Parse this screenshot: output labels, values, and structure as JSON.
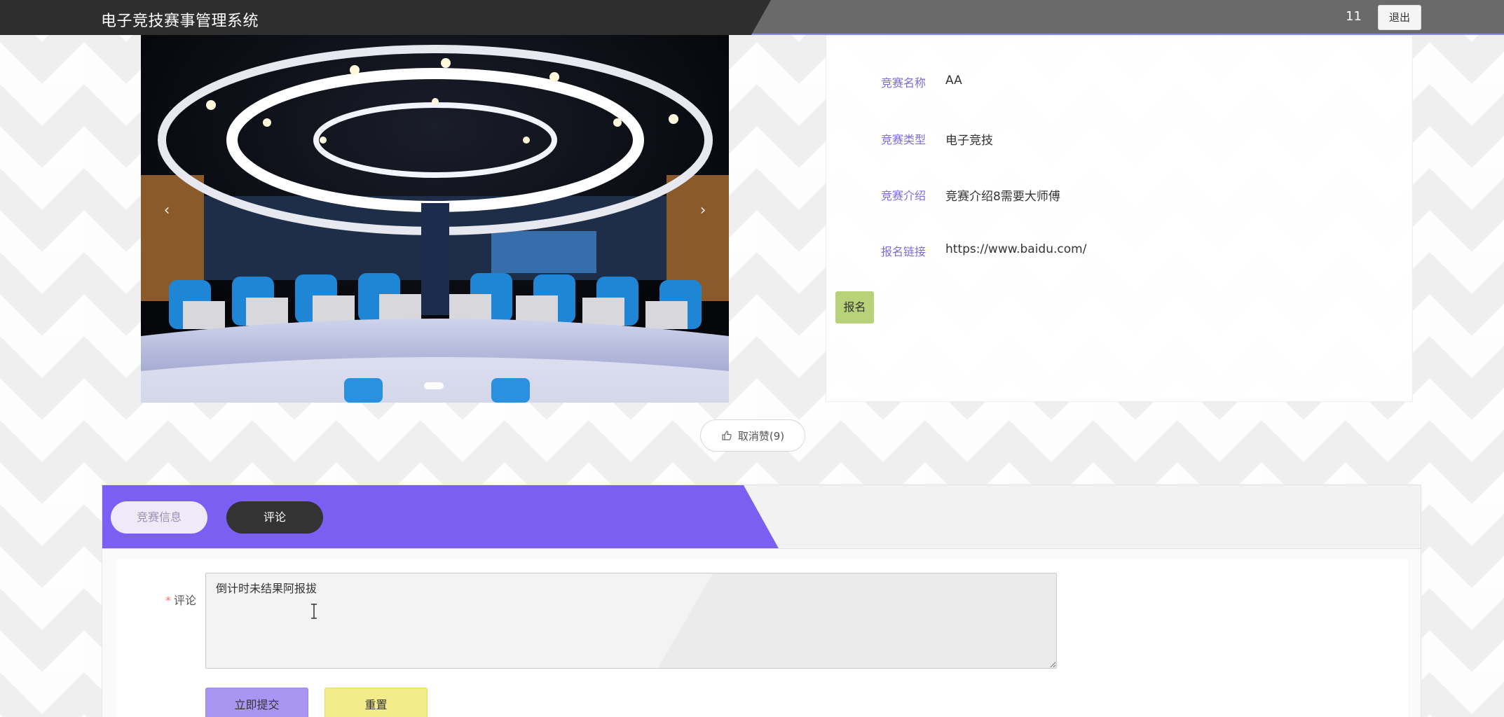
{
  "header": {
    "title": "电子竞技赛事管理系统",
    "username": "11",
    "logout_label": "退出"
  },
  "carousel": {
    "image_desc": "esports-arena-photo",
    "prev_icon": "‹",
    "next_icon": "›",
    "active_index": 0
  },
  "details": {
    "name_label": "竞赛名称",
    "name_value": "AA",
    "type_label": "竞赛类型",
    "type_value": "电子竞技",
    "intro_label": "竞赛介绍",
    "intro_value": "竞赛介绍8需要大师傅",
    "link_label": "报名链接",
    "link_value": "https://www.baidu.com/",
    "signup_label": "报名"
  },
  "like": {
    "label": "取消赞(9)"
  },
  "tabs": {
    "info_label": "竞赛信息",
    "comment_label": "评论",
    "active": "comment"
  },
  "comment_form": {
    "label": "评论",
    "required_mark": "*",
    "value": "倒计时未结果阿报拔",
    "submit_label": "立即提交",
    "reset_label": "重置"
  },
  "colors": {
    "accent_purple": "#7a5ff2",
    "label_purple": "#7b6cd9",
    "signup_green": "#b8d27a",
    "reset_yellow": "#f4ec8a",
    "header_dark": "#2e2e2e"
  }
}
